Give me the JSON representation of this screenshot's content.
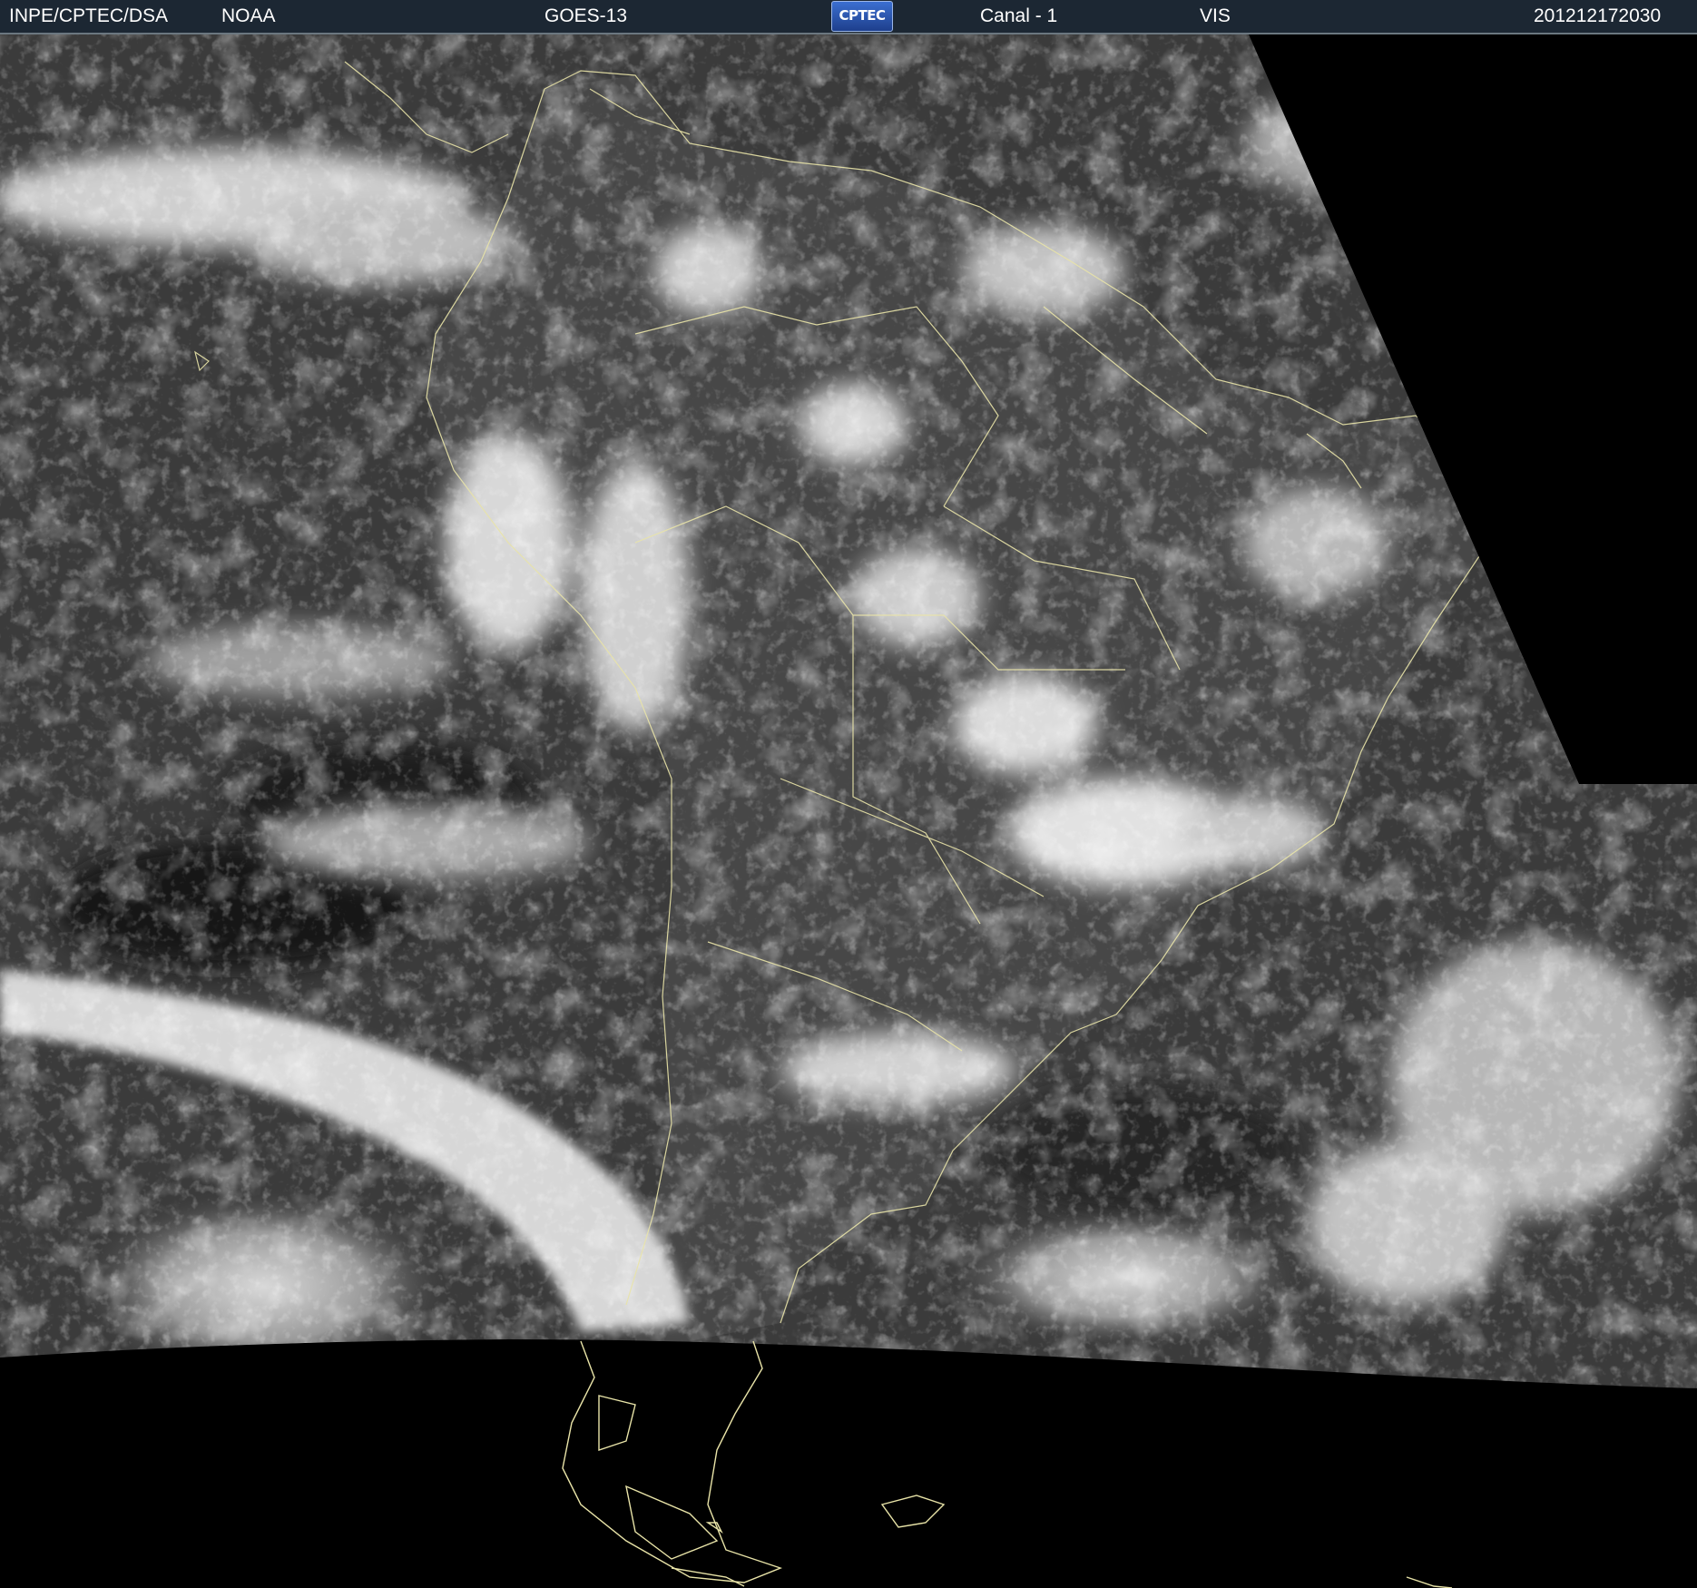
{
  "header": {
    "agency": "INPE/CPTEC/DSA",
    "partner": "NOAA",
    "satellite": "GOES-13",
    "logo_text": "CPTEC",
    "channel": "Canal - 1",
    "band": "VIS",
    "timestamp": "201212172030"
  },
  "colors": {
    "header_bg": "#1c2733",
    "space": "#000000",
    "ocean": "#3a3a3a",
    "land": "#484848",
    "cloud": "#e8e8e8",
    "coastline": "#e9e4a8"
  },
  "imagery": {
    "icon": "satellite-image-icon"
  }
}
